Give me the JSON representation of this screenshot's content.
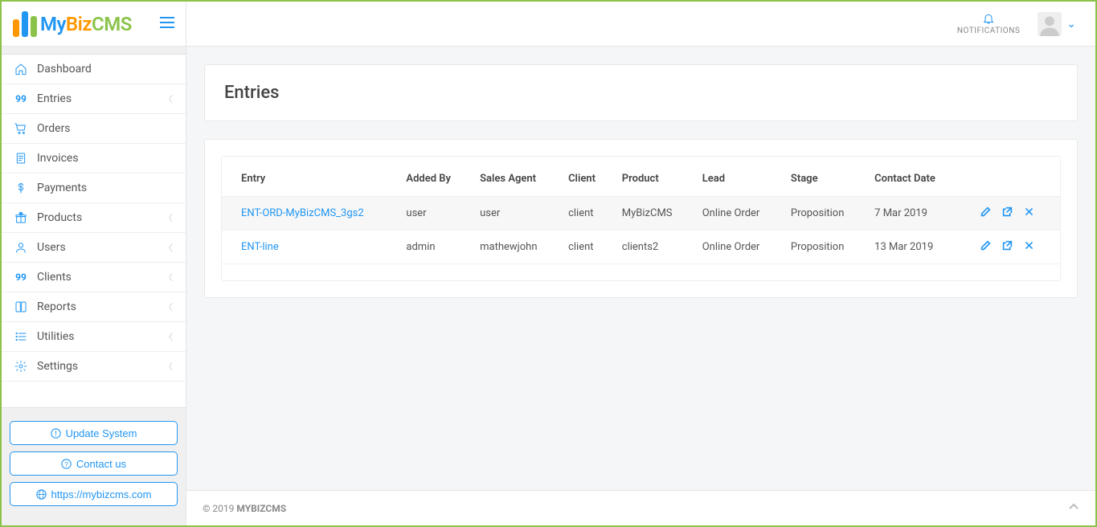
{
  "brand": {
    "my": "My",
    "biz": "Biz",
    "cms": "CMS"
  },
  "header": {
    "notifications_label": "NOTIFICATIONS"
  },
  "sidebar": {
    "items": [
      {
        "label": "Dashboard",
        "icon": "home",
        "expandable": false
      },
      {
        "label": "Entries",
        "icon": "99",
        "expandable": true
      },
      {
        "label": "Orders",
        "icon": "cart",
        "expandable": false
      },
      {
        "label": "Invoices",
        "icon": "invoice",
        "expandable": false
      },
      {
        "label": "Payments",
        "icon": "dollar",
        "expandable": false
      },
      {
        "label": "Products",
        "icon": "gift",
        "expandable": true
      },
      {
        "label": "Users",
        "icon": "user",
        "expandable": true
      },
      {
        "label": "Clients",
        "icon": "99",
        "expandable": true
      },
      {
        "label": "Reports",
        "icon": "book",
        "expandable": true
      },
      {
        "label": "Utilities",
        "icon": "list",
        "expandable": true
      },
      {
        "label": "Settings",
        "icon": "gear",
        "expandable": true
      }
    ],
    "buttons": {
      "update": "Update System",
      "contact": "Contact us",
      "site": "https://mybizcms.com"
    }
  },
  "page": {
    "title": "Entries",
    "columns": [
      "Entry",
      "Added By",
      "Sales Agent",
      "Client",
      "Product",
      "Lead",
      "Stage",
      "Contact Date"
    ],
    "rows": [
      {
        "entry": "ENT-ORD-MyBizCMS_3gs2",
        "added_by": "user",
        "sales_agent": "user",
        "client": "client",
        "product": "MyBizCMS",
        "lead": "Online Order",
        "stage": "Proposition",
        "contact_date": "7 Mar 2019"
      },
      {
        "entry": "ENT-line",
        "added_by": "admin",
        "sales_agent": "mathewjohn",
        "client": "client",
        "product": "clients2",
        "lead": "Online Order",
        "stage": "Proposition",
        "contact_date": "13 Mar 2019"
      }
    ]
  },
  "footer": {
    "copyright": "© 2019 ",
    "brand": "MYBIZCMS"
  }
}
